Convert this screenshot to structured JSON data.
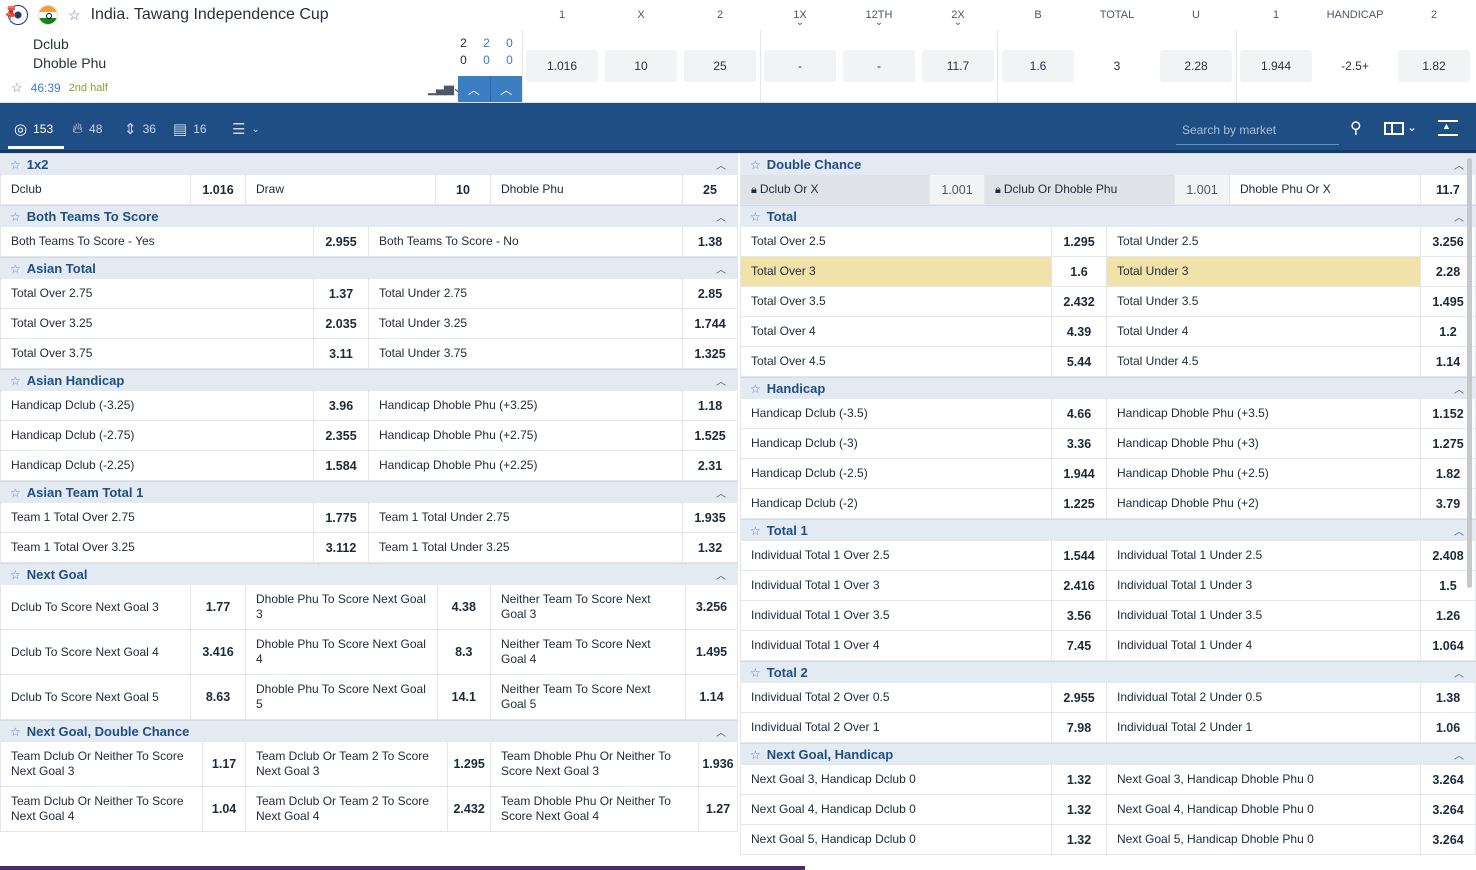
{
  "header": {
    "tournament": "India. Tawang Independence Cup",
    "team1": "Dclub",
    "team2": "Dhoble Phu",
    "score_team1": [
      "2",
      "2",
      "0"
    ],
    "score_team2": [
      "0",
      "0",
      "0"
    ],
    "time": "46:39",
    "half": "2nd half",
    "columns": [
      "1",
      "X",
      "2",
      "1X",
      "12TH",
      "2X",
      "B",
      "TOTAL",
      "U",
      "1",
      "HANDICAP",
      "2"
    ],
    "odds": [
      "1.016",
      "10",
      "25",
      "-",
      "-",
      "11.7",
      "1.6",
      "3",
      "2.28",
      "1.944",
      "-2.5+",
      "1.82"
    ]
  },
  "toolbar": {
    "tabs": [
      {
        "icon": "target-icon",
        "count": "153"
      },
      {
        "icon": "fire-icon",
        "count": "48"
      },
      {
        "icon": "updown-icon",
        "count": "36"
      },
      {
        "icon": "stats-icon",
        "count": "16"
      }
    ],
    "search_placeholder": "Search by market"
  },
  "left_groups": [
    {
      "title": "1x2",
      "cols": 3,
      "rows": [
        [
          [
            "Dclub",
            "1.016"
          ],
          [
            "Draw",
            "10"
          ],
          [
            "Dhoble Phu",
            "25"
          ]
        ]
      ]
    },
    {
      "title": "Both Teams To Score",
      "cols": 2,
      "rows": [
        [
          [
            "Both Teams To Score - Yes",
            "2.955"
          ],
          [
            "Both Teams To Score - No",
            "1.38"
          ]
        ]
      ]
    },
    {
      "title": "Asian Total",
      "cols": 2,
      "rows": [
        [
          [
            "Total Over 2.75",
            "1.37"
          ],
          [
            "Total Under 2.75",
            "2.85"
          ]
        ],
        [
          [
            "Total Over 3.25",
            "2.035"
          ],
          [
            "Total Under 3.25",
            "1.744"
          ]
        ],
        [
          [
            "Total Over 3.75",
            "3.11"
          ],
          [
            "Total Under 3.75",
            "1.325"
          ]
        ]
      ]
    },
    {
      "title": "Asian Handicap",
      "cols": 2,
      "rows": [
        [
          [
            "Handicap Dclub (-3.25)",
            "3.96"
          ],
          [
            "Handicap Dhoble Phu (+3.25)",
            "1.18"
          ]
        ],
        [
          [
            "Handicap Dclub (-2.75)",
            "2.355"
          ],
          [
            "Handicap Dhoble Phu (+2.75)",
            "1.525"
          ]
        ],
        [
          [
            "Handicap Dclub (-2.25)",
            "1.584"
          ],
          [
            "Handicap Dhoble Phu (+2.25)",
            "2.31"
          ]
        ]
      ]
    },
    {
      "title": "Asian Team Total 1",
      "cols": 2,
      "rows": [
        [
          [
            "Team 1 Total Over 2.75",
            "1.775"
          ],
          [
            "Team 1 Total Under 2.75",
            "1.935"
          ]
        ],
        [
          [
            "Team 1 Total Over 3.25",
            "3.112"
          ],
          [
            "Team 1 Total Under 3.25",
            "1.32"
          ]
        ]
      ]
    },
    {
      "title": "Next Goal",
      "cols": 3,
      "tall": true,
      "rows": [
        [
          [
            "Dclub To Score Next Goal 3",
            "1.77"
          ],
          [
            "Dhoble Phu To Score Next Goal 3",
            "4.38"
          ],
          [
            "Neither Team To Score Next Goal 3",
            "3.256"
          ]
        ],
        [
          [
            "Dclub To Score Next Goal 4",
            "3.416"
          ],
          [
            "Dhoble Phu To Score Next Goal 4",
            "8.3"
          ],
          [
            "Neither Team To Score Next Goal 4",
            "1.495"
          ]
        ],
        [
          [
            "Dclub To Score Next Goal 5",
            "8.63"
          ],
          [
            "Dhoble Phu To Score Next Goal 5",
            "14.1"
          ],
          [
            "Neither Team To Score Next Goal 5",
            "1.14"
          ]
        ]
      ]
    },
    {
      "title": "Next Goal, Double Chance",
      "cols": 3,
      "tall": true,
      "rows": [
        [
          [
            "Team Dclub Or Neither To Score Next Goal 3",
            "1.17"
          ],
          [
            "Team Dclub Or Team 2 To Score Next Goal 3",
            "1.295"
          ],
          [
            "Team Dhoble Phu Or Neither To Score Next Goal 3",
            "1.936"
          ]
        ],
        [
          [
            "Team Dclub Or Neither To Score Next Goal 4",
            "1.04"
          ],
          [
            "Team Dclub Or Team 2 To Score Next Goal 4",
            "2.432"
          ],
          [
            "Team Dhoble Phu Or Neither To Score Next Goal 4",
            "1.27"
          ]
        ]
      ]
    }
  ],
  "right_groups": [
    {
      "title": "Double Chance",
      "cols": 3,
      "rows": [
        [
          [
            "Dclub Or X",
            "1.001",
            "lock"
          ],
          [
            "Dclub Or Dhoble Phu",
            "1.001",
            "lock"
          ],
          [
            "Dhoble Phu Or X",
            "11.7"
          ]
        ]
      ]
    },
    {
      "title": "Total",
      "cols": 2,
      "rows": [
        [
          [
            "Total Over 2.5",
            "1.295"
          ],
          [
            "Total Under 2.5",
            "3.256"
          ]
        ],
        [
          [
            "Total Over 3",
            "1.6",
            "hl"
          ],
          [
            "Total Under 3",
            "2.28",
            "hl"
          ]
        ],
        [
          [
            "Total Over 3.5",
            "2.432"
          ],
          [
            "Total Under 3.5",
            "1.495"
          ]
        ],
        [
          [
            "Total Over 4",
            "4.39"
          ],
          [
            "Total Under 4",
            "1.2"
          ]
        ],
        [
          [
            "Total Over 4.5",
            "5.44"
          ],
          [
            "Total Under 4.5",
            "1.14"
          ]
        ]
      ]
    },
    {
      "title": "Handicap",
      "cols": 2,
      "rows": [
        [
          [
            "Handicap Dclub (-3.5)",
            "4.66"
          ],
          [
            "Handicap Dhoble Phu (+3.5)",
            "1.152"
          ]
        ],
        [
          [
            "Handicap Dclub (-3)",
            "3.36"
          ],
          [
            "Handicap Dhoble Phu (+3)",
            "1.275"
          ]
        ],
        [
          [
            "Handicap Dclub (-2.5)",
            "1.944"
          ],
          [
            "Handicap Dhoble Phu (+2.5)",
            "1.82"
          ]
        ],
        [
          [
            "Handicap Dclub (-2)",
            "1.225"
          ],
          [
            "Handicap Dhoble Phu (+2)",
            "3.79"
          ]
        ]
      ]
    },
    {
      "title": "Total 1",
      "cols": 2,
      "rows": [
        [
          [
            "Individual Total 1 Over 2.5",
            "1.544"
          ],
          [
            "Individual Total 1 Under 2.5",
            "2.408"
          ]
        ],
        [
          [
            "Individual Total 1 Over 3",
            "2.416"
          ],
          [
            "Individual Total 1 Under 3",
            "1.5"
          ]
        ],
        [
          [
            "Individual Total 1 Over 3.5",
            "3.56"
          ],
          [
            "Individual Total 1 Under 3.5",
            "1.26"
          ]
        ],
        [
          [
            "Individual Total 1 Over 4",
            "7.45"
          ],
          [
            "Individual Total 1 Under 4",
            "1.064"
          ]
        ]
      ]
    },
    {
      "title": "Total 2",
      "cols": 2,
      "rows": [
        [
          [
            "Individual Total 2 Over 0.5",
            "2.955"
          ],
          [
            "Individual Total 2 Under 0.5",
            "1.38"
          ]
        ],
        [
          [
            "Individual Total 2 Over 1",
            "7.98"
          ],
          [
            "Individual Total 2 Under 1",
            "1.06"
          ]
        ]
      ]
    },
    {
      "title": "Next Goal, Handicap",
      "cols": 2,
      "rows": [
        [
          [
            "Next Goal 3, Handicap Dclub 0",
            "1.32"
          ],
          [
            "Next Goal 3, Handicap Dhoble Phu 0",
            "3.264"
          ]
        ],
        [
          [
            "Next Goal 4, Handicap Dclub 0",
            "1.32"
          ],
          [
            "Next Goal 4, Handicap Dhoble Phu 0",
            "3.264"
          ]
        ],
        [
          [
            "Next Goal 5, Handicap Dclub 0",
            "1.32"
          ],
          [
            "Next Goal 5, Handicap Dhoble Phu 0",
            "3.264"
          ]
        ]
      ]
    }
  ]
}
